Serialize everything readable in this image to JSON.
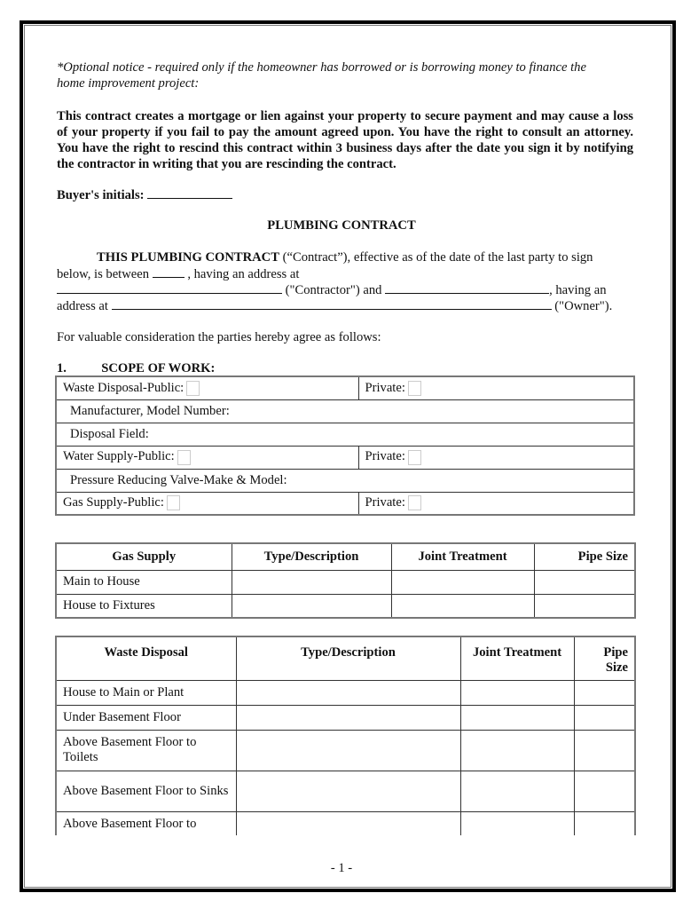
{
  "notice": {
    "optional_line1": "*Optional notice - required only if the homeowner has borrowed or is borrowing money to finance the",
    "optional_line2": "home improvement project:",
    "warning": "This contract creates a mortgage or lien against your property to secure payment and may cause a loss of your property if you fail to pay the amount agreed upon.  You have the right to consult an attorney.  You have the right to rescind this contract within 3 business days after the date you sign it by notifying the contractor in writing that you are rescinding the contract.",
    "initials_label": "Buyer's initials:"
  },
  "title": "PLUMBING CONTRACT",
  "intro": {
    "lead_bold": "THIS PLUMBING CONTRACT",
    "lead_rest": " (“Contract”), effective as of the date of the last party to sign",
    "line2_a": "below, is between",
    "line2_b": " , having an address at",
    "line3_a": " (\"Contractor\") and",
    "line3_b": ", having an",
    "line4_a": "address at",
    "line4_b": " (\"Owner\")."
  },
  "consideration": "For valuable consideration the parties hereby agree as follows:",
  "section1": {
    "number": "1.",
    "heading": "SCOPE OF WORK:"
  },
  "scope_rows": {
    "waste_public": "Waste Disposal-Public:",
    "waste_private": "Private:",
    "manufacturer": "Manufacturer, Model Number:",
    "disposal_field": "Disposal Field:",
    "water_public": "Water Supply-Public:",
    "water_private": "Private:",
    "pressure_valve": "Pressure Reducing Valve-Make & Model:",
    "gas_public": "Gas Supply-Public:",
    "gas_private": "Private:"
  },
  "gas_table": {
    "headers": [
      "Gas Supply",
      "Type/Description",
      "Joint Treatment",
      "Pipe Size"
    ],
    "rows": [
      "Main to House",
      "House to Fixtures"
    ]
  },
  "waste_table": {
    "headers": [
      "Waste Disposal",
      "Type/Description",
      "Joint Treatment",
      "Pipe Size"
    ],
    "rows": [
      "House to Main or Plant",
      "Under Basement Floor",
      "Above Basement Floor to Toilets",
      "Above Basement Floor to Sinks",
      "Above Basement Floor to"
    ]
  },
  "footer": {
    "page_number": "- 1 -"
  }
}
